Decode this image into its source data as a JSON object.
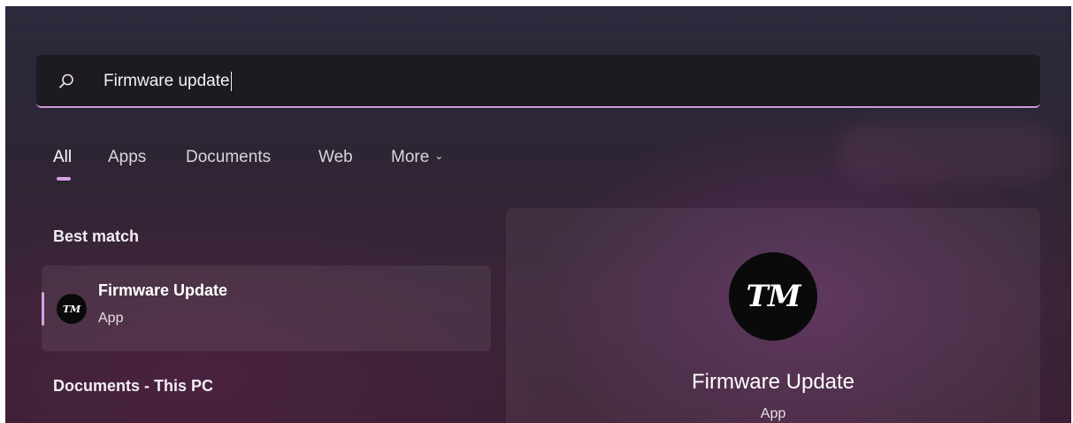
{
  "search": {
    "query": "Firmware update",
    "icon": "search-icon"
  },
  "tabs": [
    {
      "label": "All",
      "active": true
    },
    {
      "label": "Apps",
      "active": false
    },
    {
      "label": "Documents",
      "active": false
    },
    {
      "label": "Web",
      "active": false
    },
    {
      "label": "More",
      "active": false,
      "icon": "chevron-down-icon"
    }
  ],
  "best_match": {
    "heading": "Best match",
    "item": {
      "title": "Firmware Update",
      "subtitle": "App",
      "icon_text": "TM"
    }
  },
  "documents_section": {
    "heading": "Documents - This PC"
  },
  "preview": {
    "icon_text": "TM",
    "title": "Firmware Update",
    "subtitle": "App"
  },
  "colors": {
    "accent": "#d6a1e0",
    "search_underline": "#c99bd6",
    "search_bg": "#1e1a22"
  }
}
